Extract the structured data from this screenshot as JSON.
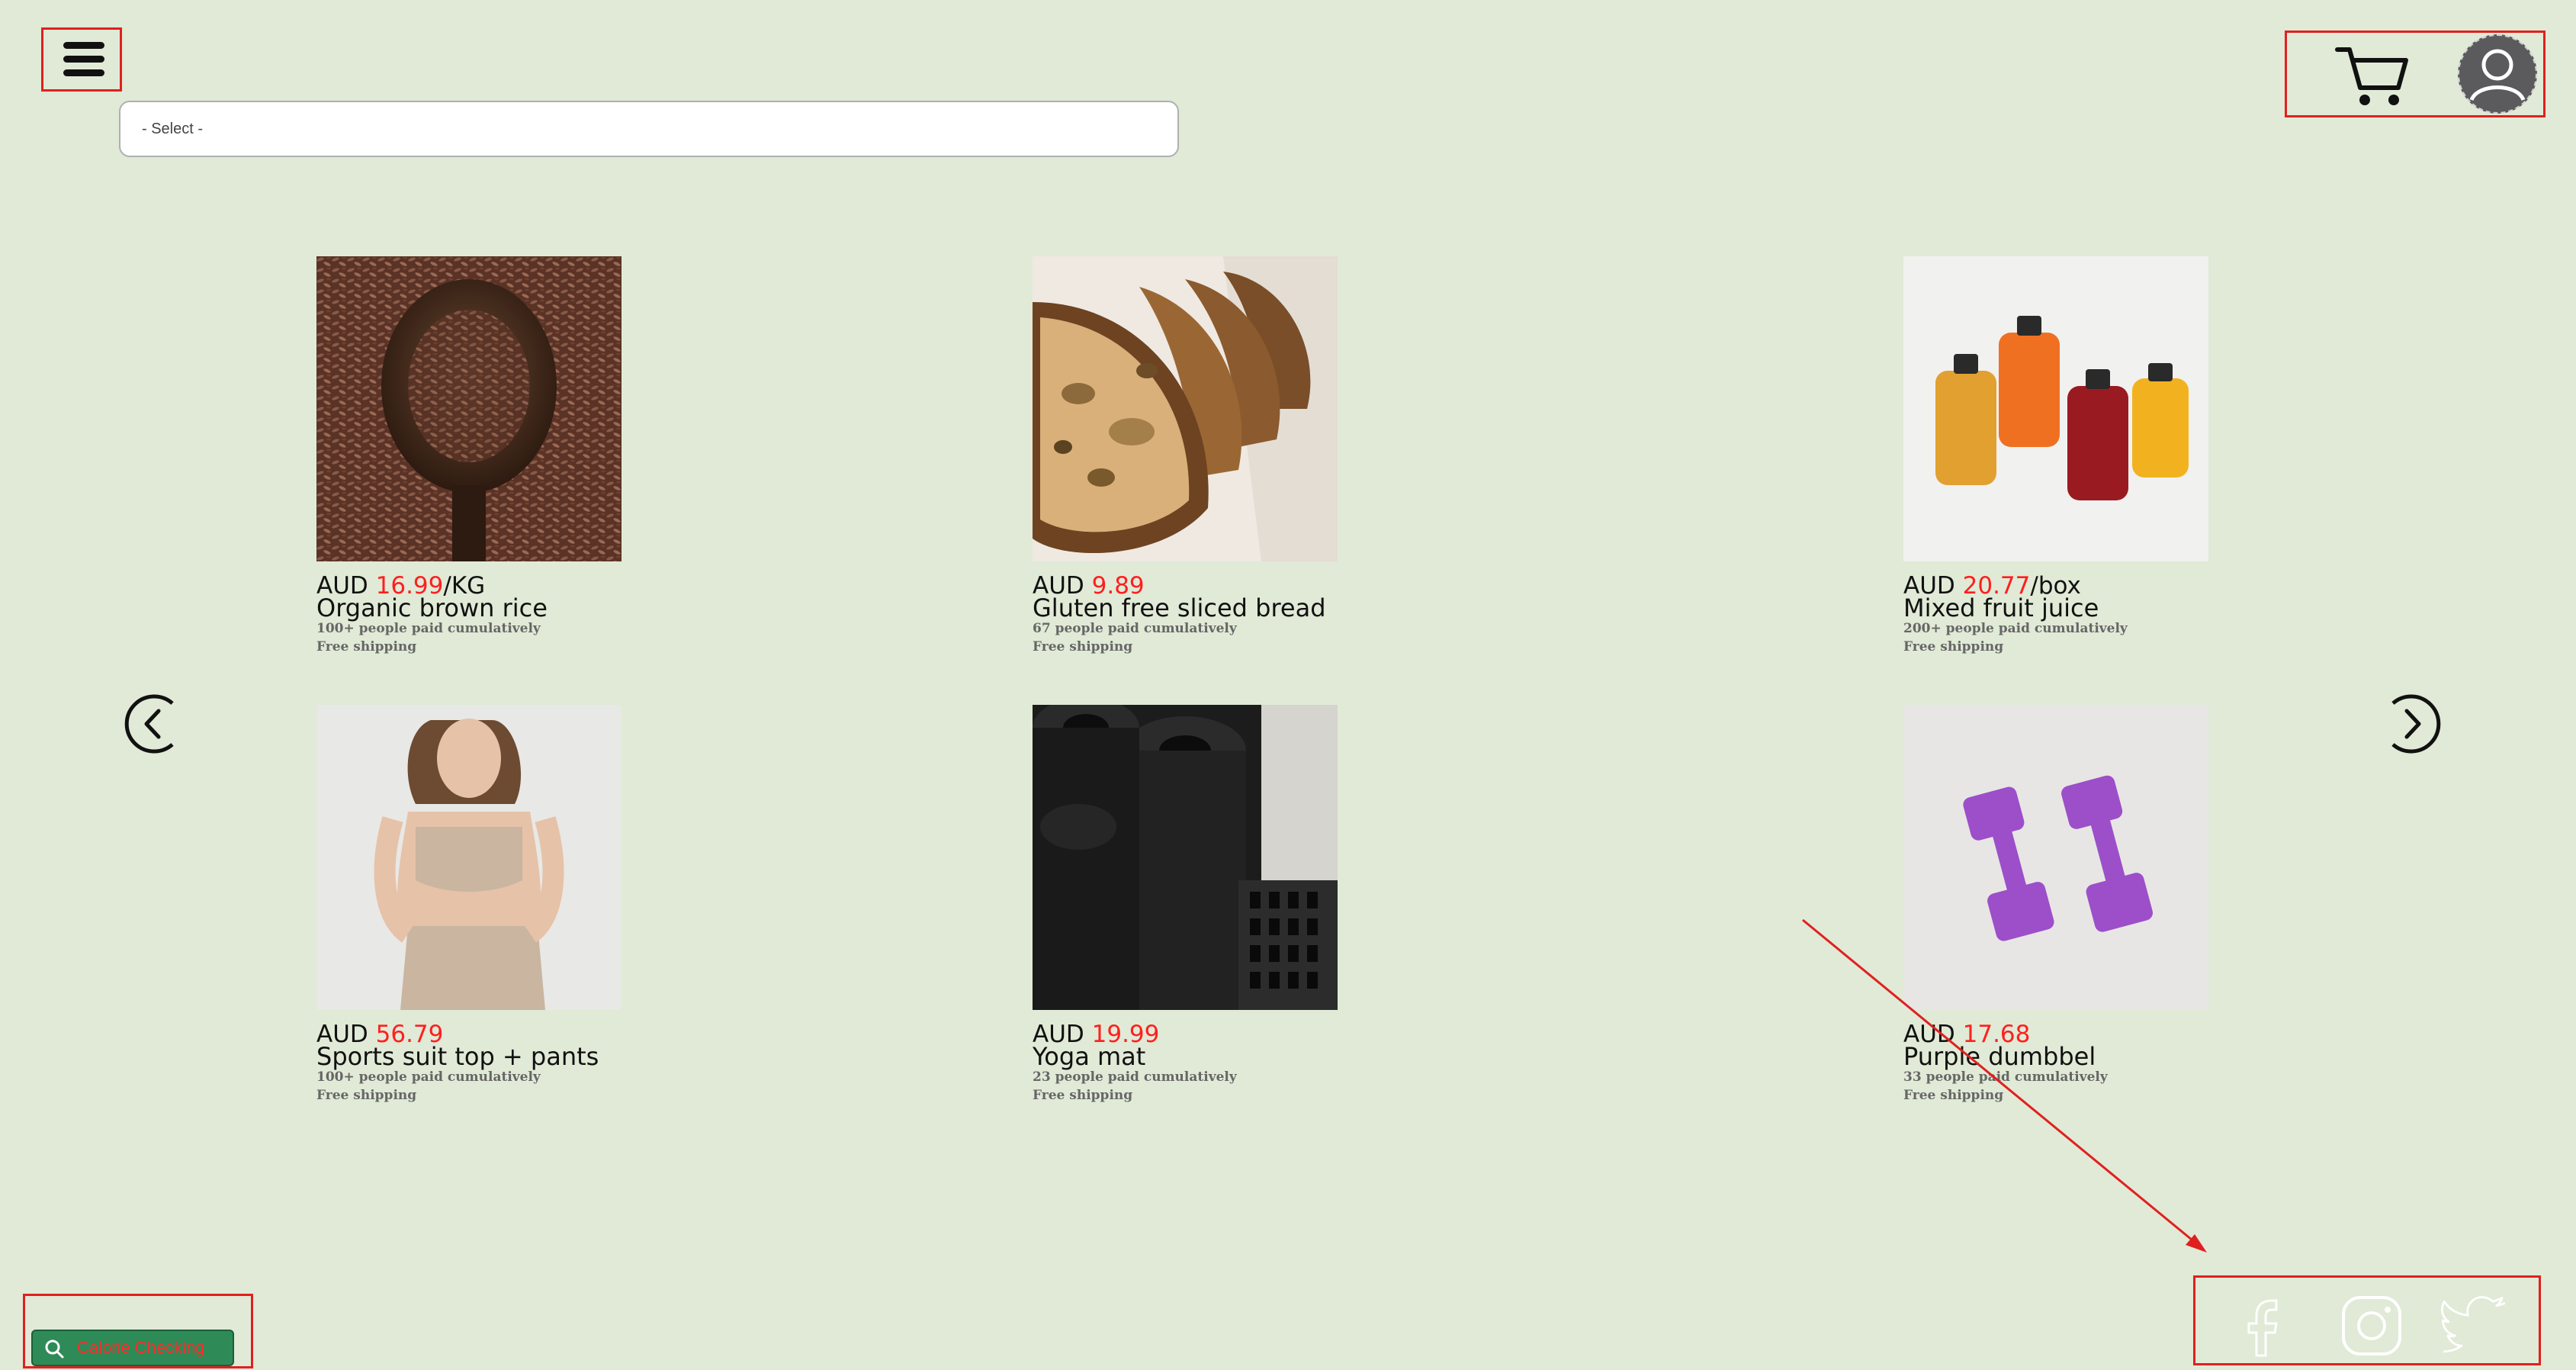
{
  "header": {
    "select": {
      "value": "- Select -"
    }
  },
  "products": [
    {
      "currency": "AUD ",
      "price": "16.99",
      "unit": "/KG",
      "name": "Organic brown rice",
      "sold": "100+ people paid cumulatively",
      "shipping": "Free shipping",
      "image": "brown-rice"
    },
    {
      "currency": "AUD ",
      "price": "9.89",
      "unit": "",
      "name": "Gluten free sliced bread",
      "sold": "67 people paid cumulatively",
      "shipping": "Free shipping",
      "image": "sliced-bread"
    },
    {
      "currency": "AUD ",
      "price": "20.77",
      "unit": "/box",
      "name": "Mixed fruit juice",
      "sold": "200+ people paid cumulatively",
      "shipping": "Free shipping",
      "image": "juice-bottles"
    },
    {
      "currency": "AUD ",
      "price": "56.79",
      "unit": "",
      "name": "Sports suit top + pants",
      "sold": "100+ people paid cumulatively",
      "shipping": "Free shipping",
      "image": "sports-suit"
    },
    {
      "currency": "AUD ",
      "price": "19.99",
      "unit": "",
      "name": "Yoga mat",
      "sold": "23 people paid cumulatively",
      "shipping": "Free shipping",
      "image": "yoga-mats"
    },
    {
      "currency": "AUD ",
      "price": "17.68",
      "unit": "",
      "name": "Purple dumbbel",
      "sold": "33 people paid cumulatively",
      "shipping": "Free shipping",
      "image": "purple-dumbbells"
    }
  ],
  "footer": {
    "calorie_button": "Calorie Checking"
  },
  "icons": {
    "menu": "hamburger-menu-icon",
    "cart": "cart-icon",
    "avatar": "user-avatar-icon",
    "prev": "chevron-left-icon",
    "next": "chevron-right-icon",
    "search": "search-icon",
    "facebook": "facebook-icon",
    "instagram": "instagram-icon",
    "twitter": "twitter-icon"
  },
  "colors": {
    "background": "#e0ead6",
    "price": "#ff1f1f",
    "annotation": "#e02020",
    "calorie_button": "#2e8b57"
  }
}
